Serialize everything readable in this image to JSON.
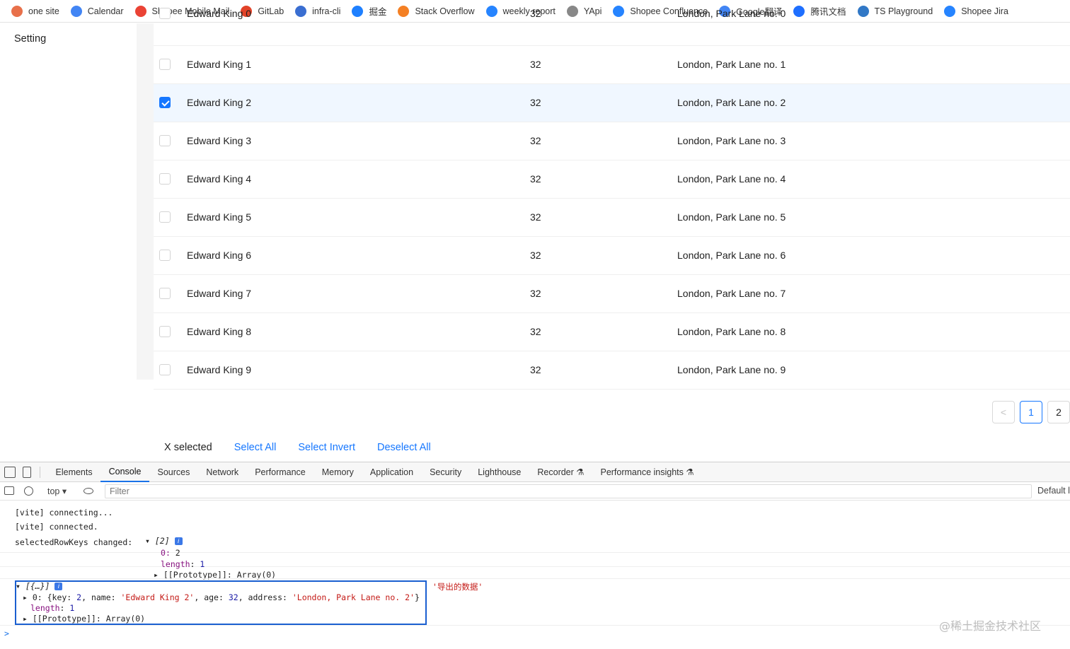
{
  "bookmarks": [
    {
      "label": "one site",
      "icon": "globe-icon",
      "color": "#e8704a"
    },
    {
      "label": "Calendar",
      "icon": "google-icon",
      "color": "#4285f4"
    },
    {
      "label": "Shopee Mobile Mail",
      "icon": "gmail-icon",
      "color": "#ea4335"
    },
    {
      "label": "GitLab",
      "icon": "gitlab-icon",
      "color": "#e24329"
    },
    {
      "label": "infra-cli",
      "icon": "infra-icon",
      "color": "#3a6ed1"
    },
    {
      "label": "掘金",
      "icon": "juejin-icon",
      "color": "#1e80ff"
    },
    {
      "label": "Stack Overflow",
      "icon": "stackoverflow-icon",
      "color": "#f48024"
    },
    {
      "label": "weekly report",
      "icon": "confluence-icon",
      "color": "#2684ff"
    },
    {
      "label": "YApi",
      "icon": "yapi-icon",
      "color": "#888888"
    },
    {
      "label": "Shopee Confluence",
      "icon": "confluence-icon",
      "color": "#2684ff"
    },
    {
      "label": "Google翻译",
      "icon": "translate-icon",
      "color": "#4285f4"
    },
    {
      "label": "腾讯文档",
      "icon": "tencent-docs-icon",
      "color": "#1e6fff"
    },
    {
      "label": "TS Playground",
      "icon": "ts-icon",
      "color": "#3178c6"
    },
    {
      "label": "Shopee Jira",
      "icon": "jira-icon",
      "color": "#2684ff"
    }
  ],
  "sidebar": {
    "items": [
      {
        "label": "Setting"
      }
    ]
  },
  "table": {
    "rows": [
      {
        "name": "Edward King 0",
        "age": "32",
        "address": "London, Park Lane no. 0",
        "selected": false
      },
      {
        "name": "Edward King 1",
        "age": "32",
        "address": "London, Park Lane no. 1",
        "selected": false
      },
      {
        "name": "Edward King 2",
        "age": "32",
        "address": "London, Park Lane no. 2",
        "selected": true
      },
      {
        "name": "Edward King 3",
        "age": "32",
        "address": "London, Park Lane no. 3",
        "selected": false
      },
      {
        "name": "Edward King 4",
        "age": "32",
        "address": "London, Park Lane no. 4",
        "selected": false
      },
      {
        "name": "Edward King 5",
        "age": "32",
        "address": "London, Park Lane no. 5",
        "selected": false
      },
      {
        "name": "Edward King 6",
        "age": "32",
        "address": "London, Park Lane no. 6",
        "selected": false
      },
      {
        "name": "Edward King 7",
        "age": "32",
        "address": "London, Park Lane no. 7",
        "selected": false
      },
      {
        "name": "Edward King 8",
        "age": "32",
        "address": "London, Park Lane no. 8",
        "selected": false
      },
      {
        "name": "Edward King 9",
        "age": "32",
        "address": "London, Park Lane no. 9",
        "selected": false
      }
    ]
  },
  "pagination": {
    "prev": "<",
    "pages": [
      "1",
      "2"
    ],
    "current": "1"
  },
  "selection": {
    "count_label": "X selected",
    "select_all": "Select All",
    "select_invert": "Select Invert",
    "deselect_all": "Deselect All"
  },
  "devtools": {
    "tabs": [
      "Elements",
      "Console",
      "Sources",
      "Network",
      "Performance",
      "Memory",
      "Application",
      "Security",
      "Lighthouse",
      "Recorder ⚗",
      "Performance insights ⚗"
    ],
    "active_tab": "Console",
    "context": "top ▾",
    "filter_placeholder": "Filter",
    "levels": "Default le",
    "console": {
      "l1": "[vite] connecting...",
      "l2": "[vite] connected.",
      "l3_label": "selectedRowKeys changed:",
      "l3_summary": "▾ [2]",
      "l3_0_key": "0",
      "l3_0_val": "2",
      "l3_len_key": "length",
      "l3_len_val": "1",
      "l3_proto": "▸ [[Prototype]]: Array(0)",
      "l4_summary": "▾ [{…}]",
      "l4_0_prefix": "▸ 0: {key: ",
      "l4_0_key": "2",
      "l4_0_mid1": ", name: ",
      "l4_0_name": "'Edward King 2'",
      "l4_0_mid2": ", age: ",
      "l4_0_age": "32",
      "l4_0_mid3": ", address: ",
      "l4_0_addr": "'London, Park Lane no. 2'",
      "l4_0_suffix": "}",
      "l4_len_key": "length",
      "l4_len_val": "1",
      "l4_proto": "▸ [[Prototype]]: Array(0)",
      "l4_label": "'导出的数据'",
      "prompt": ">"
    }
  },
  "watermark": "@稀土掘金技术社区"
}
